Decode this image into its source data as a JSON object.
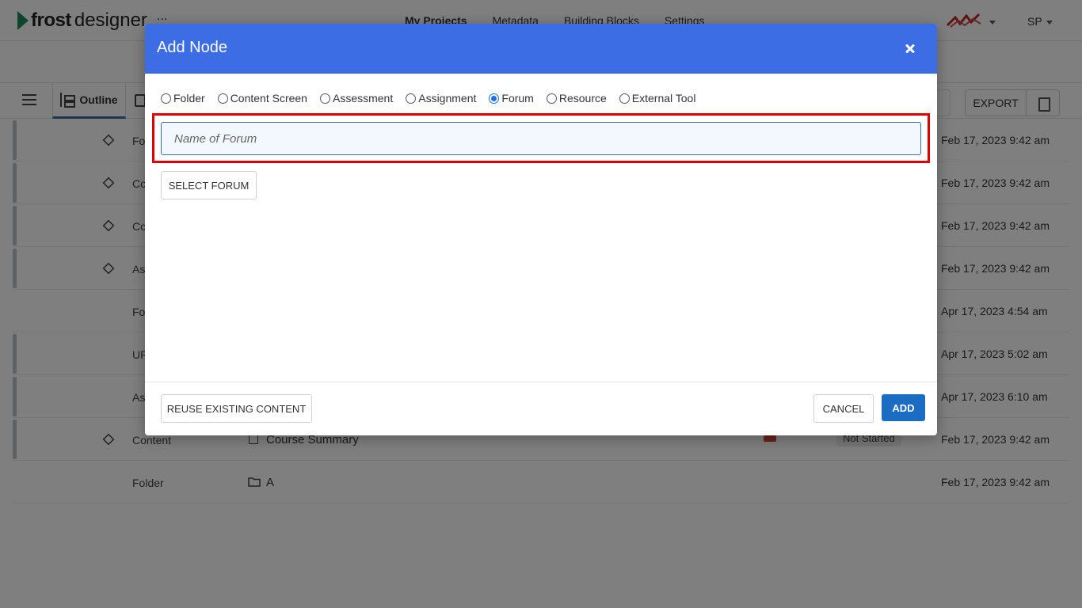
{
  "header": {
    "logo_frost": "frost",
    "logo_designer": "designer",
    "project_ellipsis": "...",
    "nav": [
      "My Projects",
      "Metadata",
      "Building Blocks",
      "Settings"
    ],
    "user_initials": "SP"
  },
  "toolbar": {
    "outline_label": "Outline",
    "export_label": "EXPORT"
  },
  "rows": [
    {
      "type": "Fo",
      "date": "Feb 17, 2023 9:42 am"
    },
    {
      "type": "Co",
      "date": "Feb 17, 2023 9:42 am"
    },
    {
      "type": "Co",
      "date": "Feb 17, 2023 9:42 am"
    },
    {
      "type": "As",
      "date": "Feb 17, 2023 9:42 am"
    },
    {
      "type": "Fo",
      "date": "Apr 17, 2023 4:54 am"
    },
    {
      "type": "UR",
      "date": "Apr 17, 2023 5:02 am"
    },
    {
      "type": "As",
      "date": "Apr 17, 2023 6:10 am"
    },
    {
      "type": "Content",
      "title": "Course Summary",
      "status": "Not Started",
      "date": "Feb 17, 2023 9:42 am"
    },
    {
      "type": "Folder",
      "title": "A",
      "date": "Feb 17, 2023 9:42 am"
    }
  ],
  "modal": {
    "title": "Add Node",
    "node_types": [
      "Folder",
      "Content Screen",
      "Assessment",
      "Assignment",
      "Forum",
      "Resource",
      "External Tool"
    ],
    "selected_type": "Forum",
    "name_input": {
      "value": "",
      "placeholder": "Name of Forum"
    },
    "select_button": "SELECT FORUM",
    "reuse_button": "REUSE EXISTING CONTENT",
    "cancel_button": "CANCEL",
    "add_button": "ADD"
  },
  "colors": {
    "modal_header": "#3c6de4",
    "add_button": "#1a6dc3",
    "highlight": "#e00000",
    "brand_green": "#1e8a5a"
  }
}
